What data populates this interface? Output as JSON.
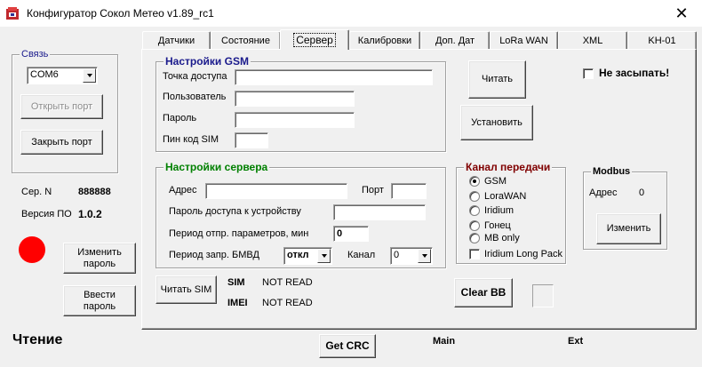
{
  "window": {
    "title": "Конфигуратор Сокол Метео v1.89_rc1",
    "close": "✕"
  },
  "connection": {
    "group_label": "Связь",
    "port_value": "COM6",
    "open_port": "Открыть порт",
    "close_port": "Закрыть порт"
  },
  "device": {
    "serial_label": "Сер. N",
    "serial_value": "888888",
    "version_label": "Версия ПО",
    "version_value": "1.0.2",
    "indicator_color": "#ff0000",
    "change_password": "Изменить пароль",
    "enter_password": "Ввести пароль",
    "status": "Чтение"
  },
  "tabs": [
    {
      "label": "Датчики"
    },
    {
      "label": "Состояние"
    },
    {
      "label": "Сервер"
    },
    {
      "label": "Калибровки"
    },
    {
      "label": "Доп. Дат"
    },
    {
      "label": "LoRa WAN"
    },
    {
      "label": "XML"
    },
    {
      "label": "KH-01"
    }
  ],
  "gsm": {
    "group_label": "Настройки GSM",
    "access_point_label": "Точка доступа",
    "access_point_value": "",
    "user_label": "Пользователь",
    "user_value": "",
    "password_label": "Пароль",
    "password_value": "",
    "pin_label": "Пин код SIM",
    "pin_value": ""
  },
  "actions": {
    "read": "Читать",
    "set": "Установить",
    "no_sleep": "Не засыпать!"
  },
  "server": {
    "group_label": "Настройки сервера",
    "address_label": "Адрес",
    "address_value": "",
    "port_label": "Порт",
    "port_value": "",
    "device_password_label": "Пароль доступа к устройству",
    "device_password_value": "",
    "send_period_label": "Период отпр. параметров, мин",
    "send_period_value": "0",
    "bmvd_label": "Период запр.  БМВД",
    "bmvd_value": "откл",
    "channel_label": "Канал",
    "channel_value": "0"
  },
  "channel": {
    "group_label": "Канал передачи",
    "options": [
      "GSM",
      "LoraWAN",
      "Iridium",
      "Гонец",
      "MB only"
    ],
    "selected": "GSM",
    "iridium_long": "Iridium Long Pack"
  },
  "modbus": {
    "group_label": "Modbus",
    "address_label": "Адрес",
    "address_value": "0",
    "change": "Изменить"
  },
  "sim": {
    "read_sim": "Читать SIM",
    "sim_label": "SIM",
    "sim_value": "NOT READ",
    "imei_label": "IMEI",
    "imei_value": "NOT READ",
    "clear_bb": "Clear BB"
  },
  "footer": {
    "get_crc": "Get CRC",
    "main": "Main",
    "ext": "Ext"
  },
  "colors": {
    "gsm_header": "#1a1a8c",
    "server_header": "#008000",
    "channel_header": "#800000",
    "modbus_header": "#000000"
  }
}
